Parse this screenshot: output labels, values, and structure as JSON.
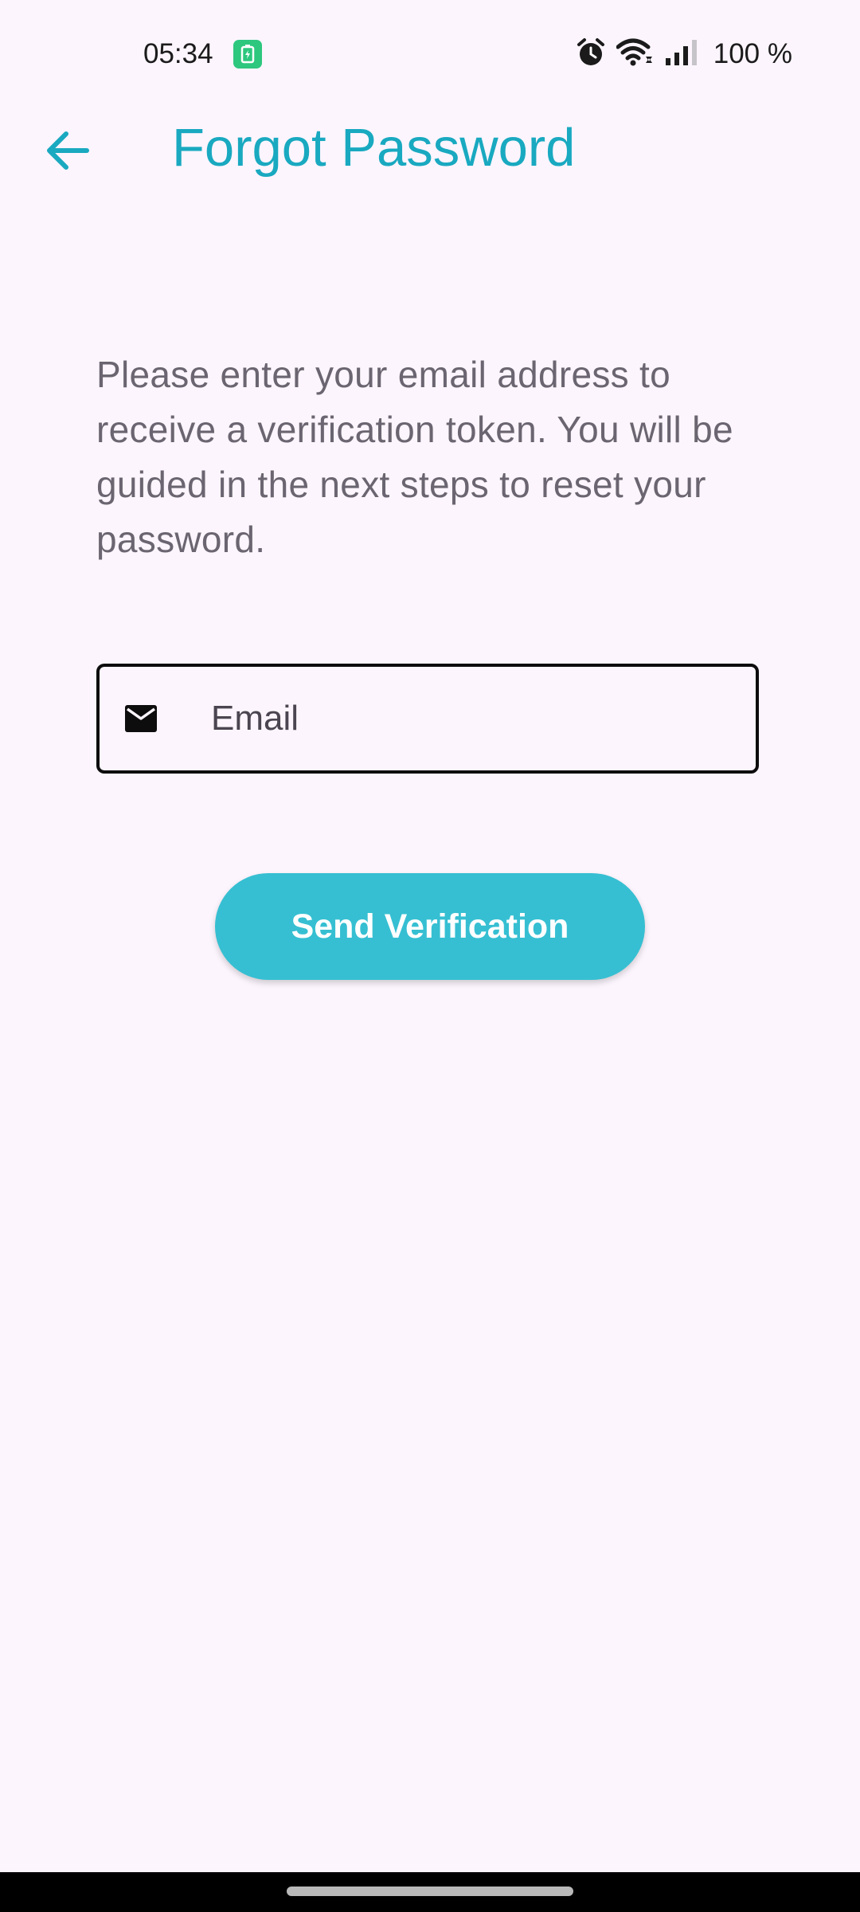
{
  "status_bar": {
    "time": "05:34",
    "battery_percent": "100 %",
    "icons": [
      "battery-saver-icon",
      "alarm-icon",
      "wifi-icon",
      "signal-icon",
      "battery-icon"
    ]
  },
  "app_bar": {
    "title": "Forgot Password",
    "back_icon": "arrow-back-icon"
  },
  "main": {
    "description": "Please enter your email address to receive a verification token. You will be guided in the next steps to reset your password.",
    "email_field": {
      "placeholder": "Email",
      "value": "",
      "icon": "mail-icon"
    },
    "send_button_label": "Send Verification"
  },
  "colors": {
    "background": "#fcf5fd",
    "accent": "#19a9c0",
    "button": "#36bfd2",
    "battery_saver": "#2dc77e"
  }
}
